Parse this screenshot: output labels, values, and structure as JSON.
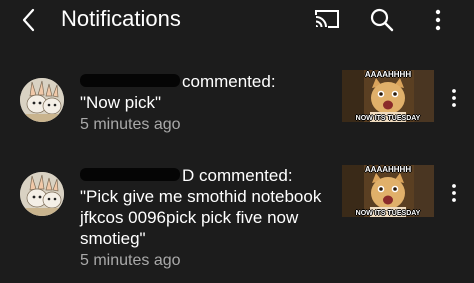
{
  "header": {
    "title": "Notifications",
    "icons": [
      "back-arrow-icon",
      "cast-icon",
      "search-icon",
      "more-vert-icon"
    ]
  },
  "notifications": [
    {
      "author_suffix": "commented:",
      "comment": "\"Now pick\"",
      "time": "5 minutes ago",
      "thumbnail_top": "AAAAHHHH",
      "thumbnail_bottom": "NOW ITS TUESDAY"
    },
    {
      "author_suffix": "D commented:",
      "comment": "\"Pick give me smothid notebook jfkcos 0096pick pick five now smotieg\"",
      "time": "5 minutes ago",
      "thumbnail_top": "AAAAHHHH",
      "thumbnail_bottom": "NOW ITS TUESDAY"
    }
  ],
  "colors": {
    "background": "#1c1c1c",
    "primary_text": "#ffffff",
    "secondary_text": "#a9a9a9"
  }
}
